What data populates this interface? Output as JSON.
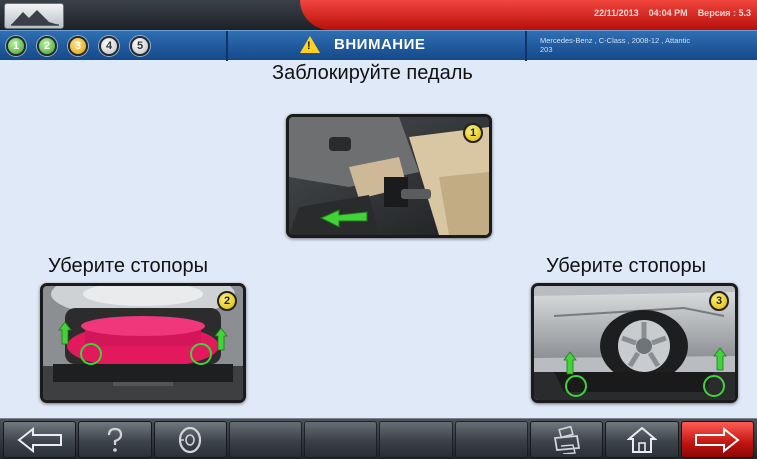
{
  "header": {
    "date": "22/11/2013",
    "time": "04:04 PM",
    "version": "Версия : 5.3"
  },
  "stepbar": {
    "steps": [
      {
        "label": "1",
        "state": "done"
      },
      {
        "label": "2",
        "state": "done"
      },
      {
        "label": "3",
        "state": "current"
      },
      {
        "label": "4",
        "state": "todo"
      },
      {
        "label": "5",
        "state": "todo"
      }
    ],
    "warning_title": "ВНИМАНИЕ",
    "vehicle_line1": "Mercedes-Benz , C-Class , 2008-12 , Attantic",
    "vehicle_line2": "203"
  },
  "main": {
    "instruction_top": "Заблокируйте педаль",
    "instruction_left": "Уберите стопоры",
    "instruction_right": "Уберите стопоры",
    "photos": [
      {
        "badge": "1",
        "subject": "brake pedal lock"
      },
      {
        "badge": "2",
        "subject": "turntable lock pins front"
      },
      {
        "badge": "3",
        "subject": "turntable lock pins rear"
      }
    ]
  },
  "toolbar": {
    "buttons": [
      {
        "icon": "back-arrow-icon",
        "enabled": true
      },
      {
        "icon": "help-icon",
        "enabled": true
      },
      {
        "icon": "tire-icon",
        "enabled": true
      },
      {
        "icon": "empty",
        "enabled": false
      },
      {
        "icon": "empty",
        "enabled": false
      },
      {
        "icon": "empty",
        "enabled": false
      },
      {
        "icon": "empty",
        "enabled": false
      },
      {
        "icon": "print-icon",
        "enabled": true
      },
      {
        "icon": "home-icon",
        "enabled": true
      },
      {
        "icon": "next-arrow-icon",
        "enabled": true
      }
    ]
  },
  "colors": {
    "accent_red": "#d8221b",
    "step_blue": "#1f5c9f",
    "background": "#dfe9f7",
    "step_done": "#3ea52a",
    "step_current": "#e0a100",
    "arrow_green": "#42d23a"
  }
}
